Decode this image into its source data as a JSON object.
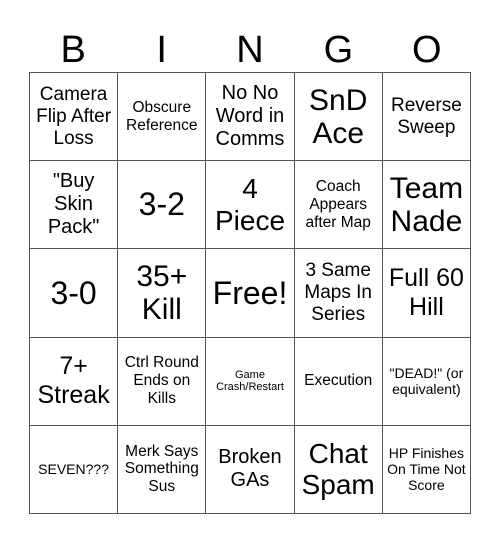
{
  "header": {
    "letters": [
      "B",
      "I",
      "N",
      "G",
      "O"
    ]
  },
  "cells": [
    "Camera Flip After Loss",
    "Obscure Reference",
    "No No Word in Comms",
    "SnD Ace",
    "Reverse Sweep",
    "\"Buy Skin Pack\"",
    "3-2",
    "4 Piece",
    "Coach Appears after Map",
    "Team Nade",
    "3-0",
    "35+ Kill",
    "Free!",
    "3 Same Maps In Series",
    "Full 60 Hill",
    "7+ Streak",
    "Ctrl Round Ends on Kills",
    "Game Crash/Restart",
    "Execution",
    "\"DEAD!\" (or equivalent)",
    "SEVEN???",
    "Merk Says Something Sus",
    "Broken GAs",
    "Chat Spam",
    "HP Finishes On Time Not Score"
  ]
}
